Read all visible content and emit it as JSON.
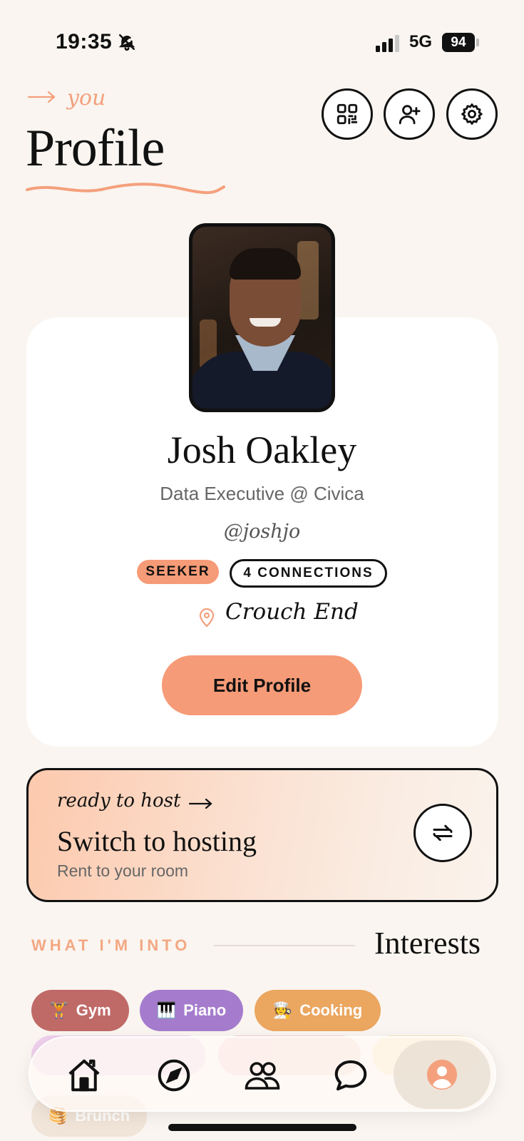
{
  "status_bar": {
    "time": "19:35",
    "network": "5G",
    "battery": "94"
  },
  "header": {
    "eyebrow": "you",
    "title": "Profile",
    "buttons": [
      {
        "icon": "qr-code-icon"
      },
      {
        "icon": "add-person-icon"
      },
      {
        "icon": "gear-icon"
      }
    ]
  },
  "profile": {
    "name": "Josh Oakley",
    "role": "Data Executive @ Civica",
    "handle": "@joshjo",
    "badge_seeker": "SEEKER",
    "badge_connections": "4 CONNECTIONS",
    "location": "Crouch End",
    "edit_label": "Edit Profile"
  },
  "hosting": {
    "eyebrow": "ready to host",
    "title": "Switch to hosting",
    "subtitle": "Rent to your room"
  },
  "interests": {
    "label": "WHAT I'M INTO",
    "title": "Interests",
    "chips": [
      {
        "emoji": "🏋️",
        "label": "Gym",
        "color": "#c06a68"
      },
      {
        "emoji": "🎹",
        "label": "Piano",
        "color": "#a57ccd"
      },
      {
        "emoji": "🧑‍🍳",
        "label": "Cooking",
        "color": "#eba65f"
      },
      {
        "emoji": "🥞",
        "label": "Brunch",
        "color": "#efe0d3"
      }
    ]
  },
  "nav": {
    "items": [
      "home-icon",
      "compass-icon",
      "people-icon",
      "chat-icon",
      "profile-icon"
    ],
    "active": "profile-icon"
  },
  "colors": {
    "accent": "#f69b77",
    "background": "#faf5f0",
    "ink": "#111111"
  }
}
